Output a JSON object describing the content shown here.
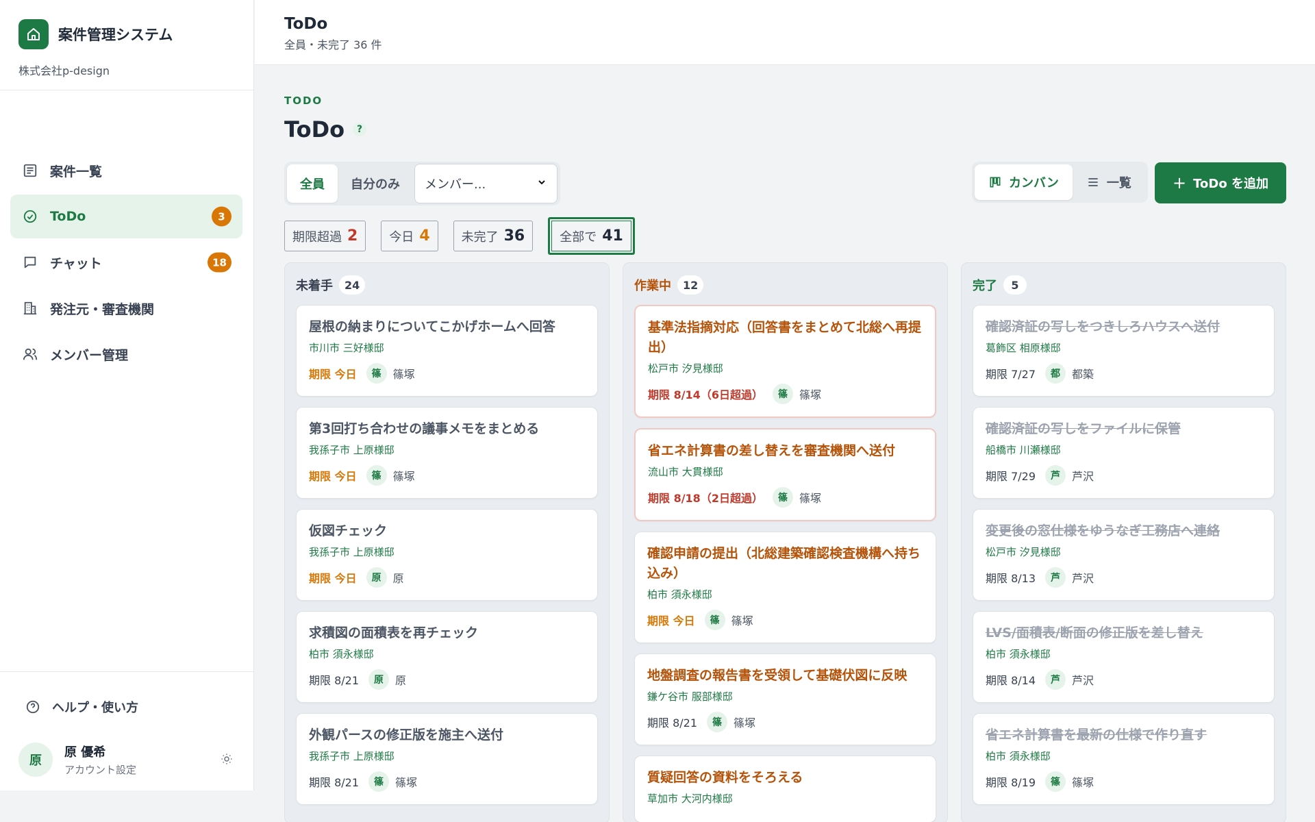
{
  "sidebar": {
    "app_title": "案件管理システム",
    "company": "株式会社p-design",
    "nav": [
      {
        "label": "案件一覧",
        "icon": "list-icon",
        "badge": ""
      },
      {
        "label": "ToDo",
        "icon": "check-circle-icon",
        "badge": "3"
      },
      {
        "label": "チャット",
        "icon": "chat-icon",
        "badge": "18"
      },
      {
        "label": "発注元・審査機関",
        "icon": "building-icon",
        "badge": ""
      },
      {
        "label": "メンバー管理",
        "icon": "users-icon",
        "badge": ""
      }
    ],
    "help_label": "ヘルプ・使い方",
    "user": {
      "initial": "原",
      "name": "原 優希",
      "sub": "アカウント設定"
    }
  },
  "header": {
    "title": "ToDo",
    "subtitle": "全員・未完了 36 件"
  },
  "page": {
    "eyebrow": "TODO",
    "title": "ToDo",
    "help": "?"
  },
  "filters": {
    "scope": [
      "全員",
      "自分のみ"
    ],
    "member_select": "メンバー..."
  },
  "view": {
    "kanban": "カンバン",
    "list": "一覧"
  },
  "add_button": "ToDo を追加",
  "stats": [
    {
      "label": "期限超過",
      "value": "2",
      "color": "#c0392b"
    },
    {
      "label": "今日",
      "value": "4",
      "color": "#d97706"
    },
    {
      "label": "未完了",
      "value": "36",
      "color": "#1f2937"
    },
    {
      "label": "全部で",
      "value": "41",
      "color": "#1f2937"
    }
  ],
  "columns": [
    {
      "name": "未着手",
      "count": "24",
      "style": "todo",
      "cards": [
        {
          "title": "屋根の納まりについてこかげホームへ回答",
          "loc": "市川市 三好様邸",
          "due": "期限 今日",
          "due_type": "today",
          "av": "篠",
          "person": "篠塚"
        },
        {
          "title": "第3回打ち合わせの議事メモをまとめる",
          "loc": "我孫子市 上原様邸",
          "due": "期限 今日",
          "due_type": "today",
          "av": "篠",
          "person": "篠塚"
        },
        {
          "title": "仮図チェック",
          "loc": "我孫子市 上原様邸",
          "due": "期限 今日",
          "due_type": "today",
          "av": "原",
          "person": "原"
        },
        {
          "title": "求積図の面積表を再チェック",
          "loc": "柏市 須永様邸",
          "due": "期限 8/21",
          "due_type": "normal",
          "av": "原",
          "person": "原"
        },
        {
          "title": "外観パースの修正版を施主へ送付",
          "loc": "我孫子市 上原様邸",
          "due": "期限 8/21",
          "due_type": "normal",
          "av": "篠",
          "person": "篠塚"
        }
      ]
    },
    {
      "name": "作業中",
      "count": "12",
      "style": "doing",
      "cards": [
        {
          "title": "基準法指摘対応（回答書をまとめて北総へ再提出）",
          "loc": "松戸市 汐見様邸",
          "due": "期限 8/14（6日超過）",
          "due_type": "late",
          "av": "篠",
          "person": "篠塚"
        },
        {
          "title": "省エネ計算書の差し替えを審査機関へ送付",
          "loc": "流山市 大貫様邸",
          "due": "期限 8/18（2日超過）",
          "due_type": "late",
          "av": "篠",
          "person": "篠塚"
        },
        {
          "title": "確認申請の提出（北総建築確認検査機構へ持ち込み）",
          "loc": "柏市 須永様邸",
          "due": "期限 今日",
          "due_type": "today",
          "av": "篠",
          "person": "篠塚"
        },
        {
          "title": "地盤調査の報告書を受領して基礎伏図に反映",
          "loc": "鎌ケ谷市 服部様邸",
          "due": "期限 8/21",
          "due_type": "normal",
          "av": "篠",
          "person": "篠塚"
        },
        {
          "title": "質疑回答の資料をそろえる",
          "loc": "草加市 大河内様邸",
          "due": "",
          "due_type": "normal",
          "av": "",
          "person": ""
        }
      ]
    },
    {
      "name": "完了",
      "count": "5",
      "style": "done",
      "cards": [
        {
          "title": "確認済証の写しをつきしろハウスへ送付",
          "loc": "葛飾区 相原様邸",
          "due": "期限 7/27",
          "due_type": "normal",
          "av": "都",
          "person": "都築"
        },
        {
          "title": "確認済証の写しをファイルに保管",
          "loc": "船橋市 川瀬様邸",
          "due": "期限 7/29",
          "due_type": "normal",
          "av": "芦",
          "person": "芦沢"
        },
        {
          "title": "変更後の窓仕様をゆうなぎ工務店へ連絡",
          "loc": "松戸市 汐見様邸",
          "due": "期限 8/13",
          "due_type": "normal",
          "av": "芦",
          "person": "芦沢"
        },
        {
          "title": "LVS/面積表/断面の修正版を差し替え",
          "loc": "柏市 須永様邸",
          "due": "期限 8/14",
          "due_type": "normal",
          "av": "芦",
          "person": "芦沢"
        },
        {
          "title": "省エネ計算書を最新の仕様で作り直す",
          "loc": "柏市 須永様邸",
          "due": "期限 8/19",
          "due_type": "normal",
          "av": "篠",
          "person": "篠塚"
        }
      ]
    }
  ]
}
